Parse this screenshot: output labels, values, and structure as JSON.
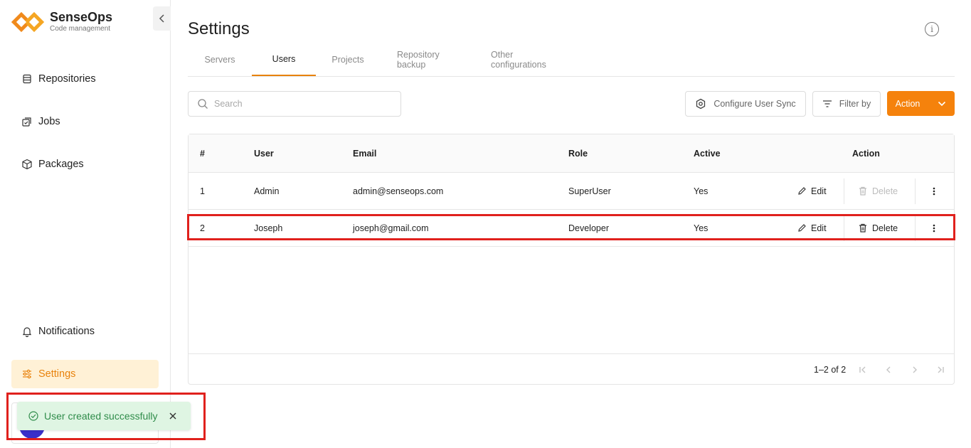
{
  "brand": {
    "name": "SenseOps",
    "subtitle": "Code management"
  },
  "sidebar": {
    "items": [
      {
        "label": "Repositories",
        "icon": "database-icon"
      },
      {
        "label": "Jobs",
        "icon": "jobs-icon"
      },
      {
        "label": "Packages",
        "icon": "package-icon"
      },
      {
        "label": "Notifications",
        "icon": "bell-icon"
      },
      {
        "label": "Settings",
        "icon": "sliders-icon",
        "active": true
      }
    ]
  },
  "page": {
    "title": "Settings"
  },
  "tabs": [
    {
      "label": "Servers"
    },
    {
      "label": "Users",
      "active": true
    },
    {
      "label": "Projects"
    },
    {
      "label": "Repository backup"
    },
    {
      "label": "Other configurations"
    }
  ],
  "toolbar": {
    "search_placeholder": "Search",
    "configure_sync_label": "Configure User Sync",
    "filter_label": "Filter by",
    "action_label": "Action"
  },
  "table": {
    "headers": {
      "num": "#",
      "user": "User",
      "email": "Email",
      "role": "Role",
      "active": "Active",
      "action": "Action"
    },
    "rows": [
      {
        "num": "1",
        "user": "Admin",
        "email": "admin@senseops.com",
        "role": "SuperUser",
        "active": "Yes",
        "delete_disabled": true
      },
      {
        "num": "2",
        "user": "Joseph",
        "email": "joseph@gmail.com",
        "role": "Developer",
        "active": "Yes",
        "delete_disabled": false
      }
    ],
    "edit_label": "Edit",
    "delete_label": "Delete",
    "pagination": {
      "range": "1–2 of 2"
    }
  },
  "toast": {
    "message": "User created successfully",
    "status": "success"
  },
  "colors": {
    "accent": "#f5820c",
    "highlight": "#e0211d",
    "toast_bg": "#dff5e3",
    "toast_text": "#2f8c4a",
    "avatar": "#3a2fc9"
  }
}
